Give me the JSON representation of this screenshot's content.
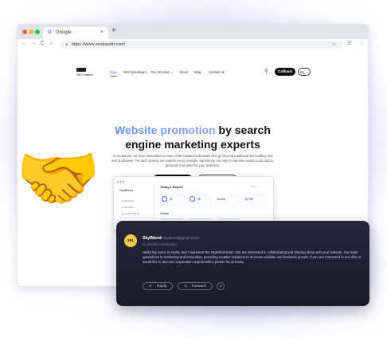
{
  "browser": {
    "tab_title": "Google",
    "tab_close": "×",
    "new_tab": "+",
    "url": "https://www.seobando.com/",
    "nav_back": "←",
    "nav_forward": "→",
    "nav_reload": "C",
    "nav_home": "⌂"
  },
  "site": {
    "logo_text": "SEO bando",
    "menu": [
      "Main",
      "SEO (prodsign)",
      "Our Services ⌄",
      "About",
      "Blog",
      "Contact us"
    ],
    "callback_label": "Callback",
    "lang_label": "EN ⌄",
    "hero_highlight": "Website promotion",
    "hero_rest": " by search",
    "hero_line2": "engine marketing experts",
    "hero_desc": "At Seobando, we have assembled a team of like-minded individuals who go beyond traditional link building and text purchases. For each project, we explore every possible opportunity, not only to improve positions but also to generate real sales for your business.",
    "contact_label": "Contact us",
    "services_label": "Services"
  },
  "dashboard": {
    "brand": "SkyBlend",
    "side_items": [
      "Dashboard",
      "Scan Page",
      "Content Settings"
    ],
    "title": "Today's Report",
    "filter": "Filter ⌄",
    "cards": [
      {
        "value": "52"
      },
      {
        "value": "98"
      },
      {
        "value": "$2,498"
      },
      {
        "value": "$2,798"
      }
    ],
    "section": "Statistic"
  },
  "email": {
    "avatar_initials": "SBL",
    "sender_name": "SkyBlend",
    "sender_email": "<skyblend@gmail.com>",
    "to_line": "to: efsterln <seobando>",
    "body": "Hello! My name is Andriy and I represent the SkyBlend team. We are interested in collaborating and sharing ideas with your website. Our team specializes in marketing and innovation, providing creative solutions to increase visibility and business growth. If you are interested in our offer or would like to discuss cooperation opportunities, please let us know.",
    "reply_label": "Reply",
    "forward_label": "Forward",
    "reply_icon": "↶",
    "forward_icon": "↷",
    "emoji_icon": "☺"
  },
  "decor": {
    "handshake_icon": "🤝"
  }
}
